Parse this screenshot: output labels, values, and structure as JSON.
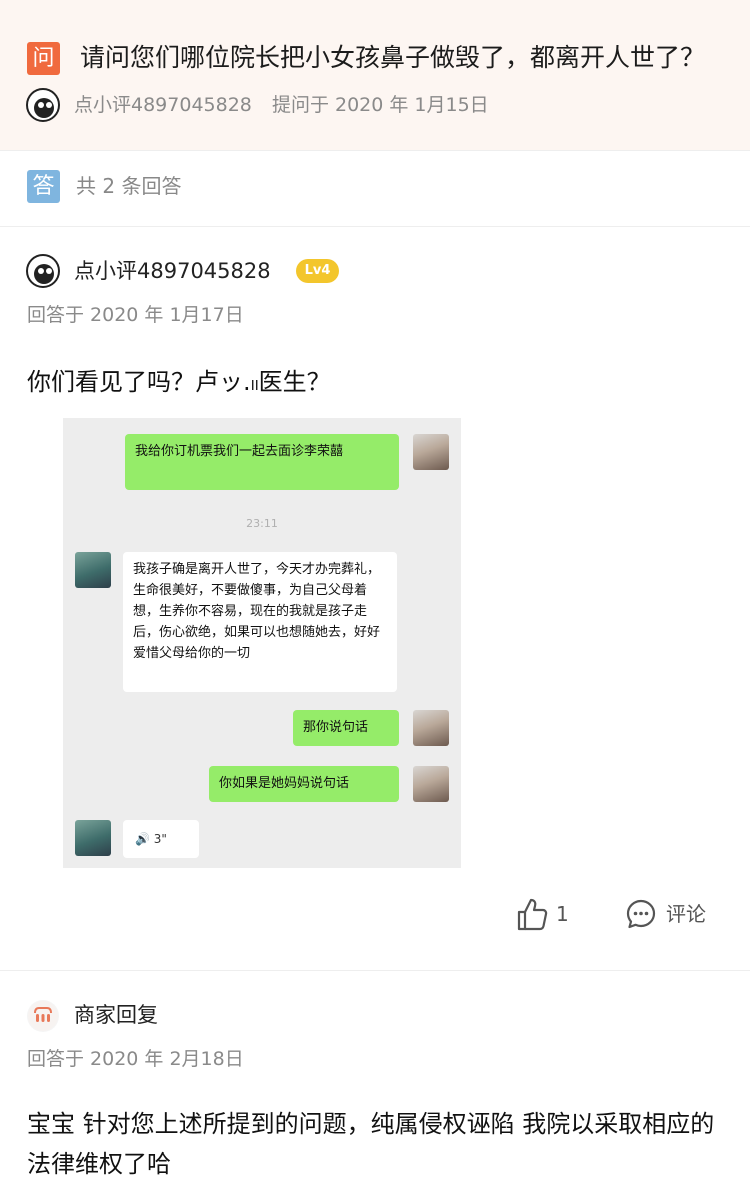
{
  "question": {
    "badge": "问",
    "title": "请问您们哪位院长把小女孩鼻子做毁了，都离开人世了？",
    "user": "点小评4897045828",
    "asked_at": "提问于 2020 年 1月15日"
  },
  "answers_header": {
    "badge": "答",
    "count_text": "共 2 条回答"
  },
  "answer": {
    "user": "点小评4897045828",
    "level": "Lv4",
    "answered_at": "回答于 2020 年 1月17日",
    "text": "你们看见了吗？卢ッ.ₗₗ医生？",
    "chat": {
      "messages": [
        {
          "side": "right",
          "text": "我给你订机票我们一起去面诊李荣囍"
        },
        {
          "side": "time",
          "text": "23:11"
        },
        {
          "side": "left",
          "text": "我孩子确是离开人世了，今天才办完葬礼，生命很美好，不要做傻事，为自己父母着想，生养你不容易，现在的我就是孩子走后，伤心欲绝，如果可以也想随她去，好好爱惜父母给你的一切"
        },
        {
          "side": "right",
          "text": "那你说句话"
        },
        {
          "side": "right",
          "text": "你如果是她妈妈说句话"
        },
        {
          "side": "left-voice",
          "text": "🔊 3\""
        }
      ]
    },
    "likes": "1",
    "comment_label": "评论"
  },
  "merchant_reply": {
    "name": "商家回复",
    "answered_at": "回答于 2020 年 2月18日",
    "text": "宝宝 针对您上述所提到的问题，纯属侵权诬陷 我院以采取相应的法律维权了哈"
  },
  "colors": {
    "question_badge": "#f06a3e",
    "answer_badge": "#7fb5df",
    "level_badge": "#f3c62c",
    "chat_green": "#95ec69"
  }
}
